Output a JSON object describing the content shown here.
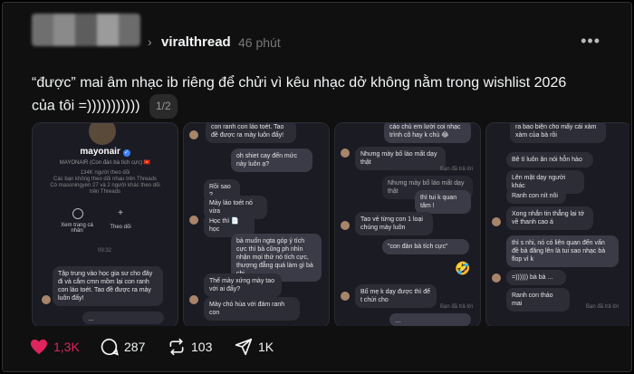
{
  "post": {
    "username": "viralthread",
    "time": "46 phút",
    "text": "“được” mai âm nhạc ib riêng để chửi vì kêu nhạc dở không nằm trong wishlist 2026 của tôi =)))))))))))",
    "page_indicator": "1/2"
  },
  "cards": {
    "card1": {
      "name": "mayonair",
      "subname": "MAYONAIR (Con đàn bà tích cực) 🇻🇳",
      "followers": "134K người theo dõi",
      "line2": "Các bạn không theo dõi nhau trên Threads",
      "line3": "Có masoningyen 27 và 2 người khác theo dõi",
      "line4": "trên Threads",
      "btn1": "Xem trang cá nhân",
      "btn2": "Theo dõi",
      "time": "09:32",
      "msg1": "Tập trung vào học gia sư cho đây đi và cắm cmn mồm lại con ranh con láo toét. Tao đề được ra mày luôn đấy!",
      "msg2": "…"
    },
    "card2": {
      "msg1": "con ranh con láo toét. Tao đề được ra mày luôn đấy!",
      "msg2": "oh shiet cay đến mức này luôn ạ?",
      "msg3": "Rồi sao ?",
      "msg4": "Mày láo toét nó vừa",
      "msg5": "Học thì 📄 học",
      "msg6": "bà muốn ngta góp ý tích cực thì bà cũng ph nhìn nhận mọi thứ nó tích cực, thượng đẳng quá làm gì bà chị",
      "msg7": "Thế mày xứng mày tao với ai đấy?",
      "msg8": "Mày chó hùa với đám ranh con"
    },
    "card3": {
      "msg1": "cáo chủ em lười coi nhạc trình cô hay k chủ 😂",
      "msg2": "Nhưng mày bố láo mất dạy thật",
      "status1": "Bạn đã trả lời",
      "msg3": "Nhưng mày bố láo mất dạy thật",
      "msg4": "thì tui k quan tâm !",
      "msg5": "Tao vẻ từng con 1 loại chúng mày luôn",
      "msg6": "\"con đàn bà tích cực\"",
      "emoji": "🤣",
      "msg7": "Bố mẹ k dạy được thì để t chửi cho",
      "status2": "Bạn đã trả lời",
      "msg8": "…"
    },
    "card4": {
      "msg1": "ra bao biện cho mấy cái xàm xàm của bà rồi",
      "msg2": "Bê tì luôn ăn nói hỗn hào",
      "msg3": "Lên mặt dạy người khác",
      "msg4": "Ranh con nít nôi",
      "msg5": "Xong nhắn tin thẳng lại tớ về thanh cao á",
      "msg6": "thì s nhi, nó có liên quan đến vấn đề bà đăng lên là tui sao nhạc bà flop vì k",
      "msg7": "=)))))) bà bà ...",
      "msg8": "Ranh con tháo mai",
      "status": "Bạn đã trả lời"
    }
  },
  "actions": {
    "likes": "1,3K",
    "comments": "287",
    "reposts": "103",
    "shares": "1K"
  },
  "colors": {
    "like": "#e0245e",
    "bg": "#101010",
    "card_bg": "#1a1b23"
  },
  "icons": [
    "heart-icon",
    "comment-icon",
    "repost-icon",
    "share-icon",
    "more-icon",
    "chevron-right-icon",
    "verified-icon"
  ]
}
